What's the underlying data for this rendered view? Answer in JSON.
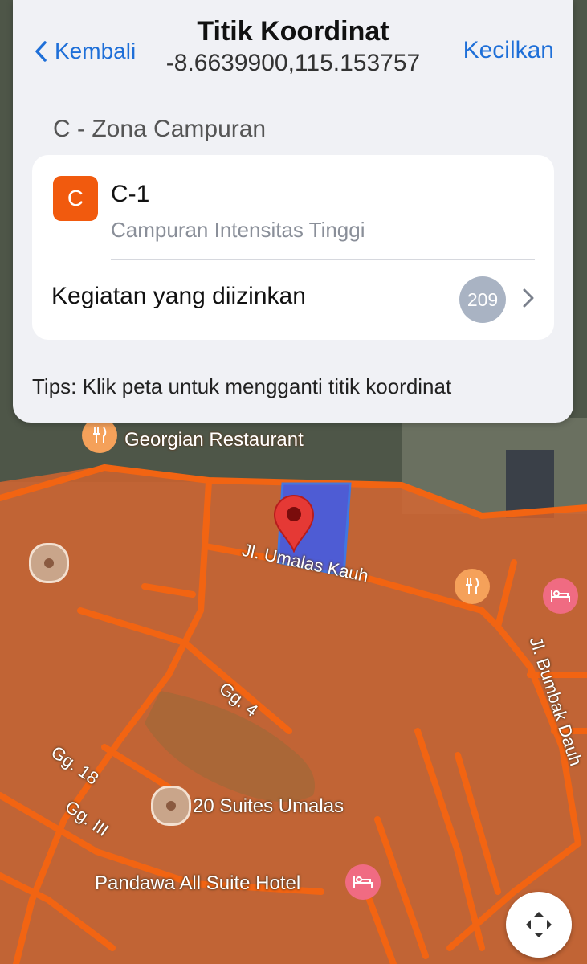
{
  "header": {
    "back_label": "Kembali",
    "title": "Titik Koordinat",
    "coordinates": "-8.6639900,115.153757",
    "minimize_label": "Kecilkan"
  },
  "zone": {
    "section_title": "C - Zona Campuran",
    "badge": "C",
    "code": "C-1",
    "description": "Campuran Intensitas Tinggi",
    "activities_label": "Kegiatan yang diizinkan",
    "activities_count": "209"
  },
  "tips": "Tips: Klik peta untuk mengganti titik koordinat",
  "map": {
    "labels": {
      "restaurant": "Georgian Restaurant",
      "suites": "20 Suites Umalas",
      "hotel": "Pandawa All Suite Hotel",
      "street_umalas": "Jl. Umalas Kauh",
      "street_bumbak": "Jl. Bumbak Dauh",
      "gg4": "Gg. 4",
      "gg18": "Gg. 18",
      "gg3": "Gg. III"
    },
    "colors": {
      "zone_overlay": "#e8652a",
      "zone_outline": "#f26412",
      "selected_parcel": "#3a5bf0",
      "pin": "#e53935"
    }
  }
}
